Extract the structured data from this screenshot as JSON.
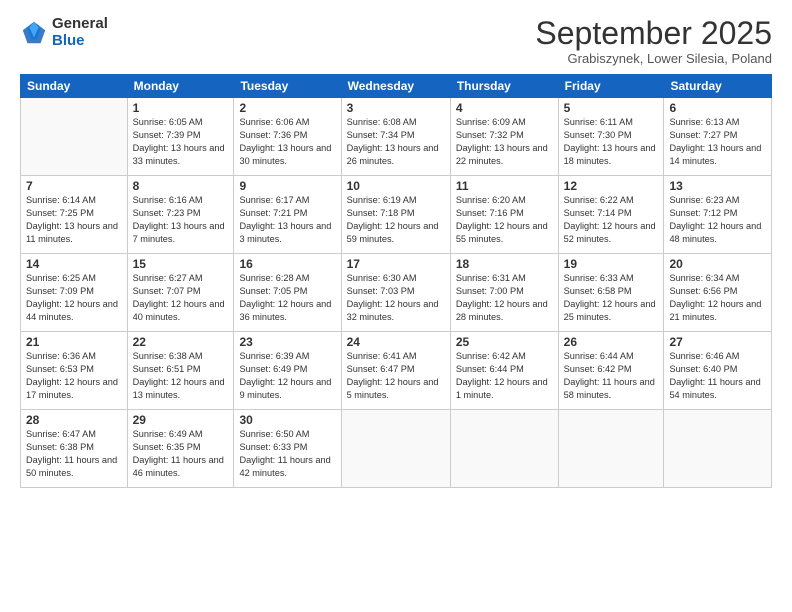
{
  "logo": {
    "general": "General",
    "blue": "Blue"
  },
  "header": {
    "month": "September 2025",
    "location": "Grabiszynek, Lower Silesia, Poland"
  },
  "weekdays": [
    "Sunday",
    "Monday",
    "Tuesday",
    "Wednesday",
    "Thursday",
    "Friday",
    "Saturday"
  ],
  "weeks": [
    [
      {
        "day": "",
        "sunrise": "",
        "sunset": "",
        "daylight": ""
      },
      {
        "day": "1",
        "sunrise": "Sunrise: 6:05 AM",
        "sunset": "Sunset: 7:39 PM",
        "daylight": "Daylight: 13 hours and 33 minutes."
      },
      {
        "day": "2",
        "sunrise": "Sunrise: 6:06 AM",
        "sunset": "Sunset: 7:36 PM",
        "daylight": "Daylight: 13 hours and 30 minutes."
      },
      {
        "day": "3",
        "sunrise": "Sunrise: 6:08 AM",
        "sunset": "Sunset: 7:34 PM",
        "daylight": "Daylight: 13 hours and 26 minutes."
      },
      {
        "day": "4",
        "sunrise": "Sunrise: 6:09 AM",
        "sunset": "Sunset: 7:32 PM",
        "daylight": "Daylight: 13 hours and 22 minutes."
      },
      {
        "day": "5",
        "sunrise": "Sunrise: 6:11 AM",
        "sunset": "Sunset: 7:30 PM",
        "daylight": "Daylight: 13 hours and 18 minutes."
      },
      {
        "day": "6",
        "sunrise": "Sunrise: 6:13 AM",
        "sunset": "Sunset: 7:27 PM",
        "daylight": "Daylight: 13 hours and 14 minutes."
      }
    ],
    [
      {
        "day": "7",
        "sunrise": "Sunrise: 6:14 AM",
        "sunset": "Sunset: 7:25 PM",
        "daylight": "Daylight: 13 hours and 11 minutes."
      },
      {
        "day": "8",
        "sunrise": "Sunrise: 6:16 AM",
        "sunset": "Sunset: 7:23 PM",
        "daylight": "Daylight: 13 hours and 7 minutes."
      },
      {
        "day": "9",
        "sunrise": "Sunrise: 6:17 AM",
        "sunset": "Sunset: 7:21 PM",
        "daylight": "Daylight: 13 hours and 3 minutes."
      },
      {
        "day": "10",
        "sunrise": "Sunrise: 6:19 AM",
        "sunset": "Sunset: 7:18 PM",
        "daylight": "Daylight: 12 hours and 59 minutes."
      },
      {
        "day": "11",
        "sunrise": "Sunrise: 6:20 AM",
        "sunset": "Sunset: 7:16 PM",
        "daylight": "Daylight: 12 hours and 55 minutes."
      },
      {
        "day": "12",
        "sunrise": "Sunrise: 6:22 AM",
        "sunset": "Sunset: 7:14 PM",
        "daylight": "Daylight: 12 hours and 52 minutes."
      },
      {
        "day": "13",
        "sunrise": "Sunrise: 6:23 AM",
        "sunset": "Sunset: 7:12 PM",
        "daylight": "Daylight: 12 hours and 48 minutes."
      }
    ],
    [
      {
        "day": "14",
        "sunrise": "Sunrise: 6:25 AM",
        "sunset": "Sunset: 7:09 PM",
        "daylight": "Daylight: 12 hours and 44 minutes."
      },
      {
        "day": "15",
        "sunrise": "Sunrise: 6:27 AM",
        "sunset": "Sunset: 7:07 PM",
        "daylight": "Daylight: 12 hours and 40 minutes."
      },
      {
        "day": "16",
        "sunrise": "Sunrise: 6:28 AM",
        "sunset": "Sunset: 7:05 PM",
        "daylight": "Daylight: 12 hours and 36 minutes."
      },
      {
        "day": "17",
        "sunrise": "Sunrise: 6:30 AM",
        "sunset": "Sunset: 7:03 PM",
        "daylight": "Daylight: 12 hours and 32 minutes."
      },
      {
        "day": "18",
        "sunrise": "Sunrise: 6:31 AM",
        "sunset": "Sunset: 7:00 PM",
        "daylight": "Daylight: 12 hours and 28 minutes."
      },
      {
        "day": "19",
        "sunrise": "Sunrise: 6:33 AM",
        "sunset": "Sunset: 6:58 PM",
        "daylight": "Daylight: 12 hours and 25 minutes."
      },
      {
        "day": "20",
        "sunrise": "Sunrise: 6:34 AM",
        "sunset": "Sunset: 6:56 PM",
        "daylight": "Daylight: 12 hours and 21 minutes."
      }
    ],
    [
      {
        "day": "21",
        "sunrise": "Sunrise: 6:36 AM",
        "sunset": "Sunset: 6:53 PM",
        "daylight": "Daylight: 12 hours and 17 minutes."
      },
      {
        "day": "22",
        "sunrise": "Sunrise: 6:38 AM",
        "sunset": "Sunset: 6:51 PM",
        "daylight": "Daylight: 12 hours and 13 minutes."
      },
      {
        "day": "23",
        "sunrise": "Sunrise: 6:39 AM",
        "sunset": "Sunset: 6:49 PM",
        "daylight": "Daylight: 12 hours and 9 minutes."
      },
      {
        "day": "24",
        "sunrise": "Sunrise: 6:41 AM",
        "sunset": "Sunset: 6:47 PM",
        "daylight": "Daylight: 12 hours and 5 minutes."
      },
      {
        "day": "25",
        "sunrise": "Sunrise: 6:42 AM",
        "sunset": "Sunset: 6:44 PM",
        "daylight": "Daylight: 12 hours and 1 minute."
      },
      {
        "day": "26",
        "sunrise": "Sunrise: 6:44 AM",
        "sunset": "Sunset: 6:42 PM",
        "daylight": "Daylight: 11 hours and 58 minutes."
      },
      {
        "day": "27",
        "sunrise": "Sunrise: 6:46 AM",
        "sunset": "Sunset: 6:40 PM",
        "daylight": "Daylight: 11 hours and 54 minutes."
      }
    ],
    [
      {
        "day": "28",
        "sunrise": "Sunrise: 6:47 AM",
        "sunset": "Sunset: 6:38 PM",
        "daylight": "Daylight: 11 hours and 50 minutes."
      },
      {
        "day": "29",
        "sunrise": "Sunrise: 6:49 AM",
        "sunset": "Sunset: 6:35 PM",
        "daylight": "Daylight: 11 hours and 46 minutes."
      },
      {
        "day": "30",
        "sunrise": "Sunrise: 6:50 AM",
        "sunset": "Sunset: 6:33 PM",
        "daylight": "Daylight: 11 hours and 42 minutes."
      },
      {
        "day": "",
        "sunrise": "",
        "sunset": "",
        "daylight": ""
      },
      {
        "day": "",
        "sunrise": "",
        "sunset": "",
        "daylight": ""
      },
      {
        "day": "",
        "sunrise": "",
        "sunset": "",
        "daylight": ""
      },
      {
        "day": "",
        "sunrise": "",
        "sunset": "",
        "daylight": ""
      }
    ]
  ]
}
